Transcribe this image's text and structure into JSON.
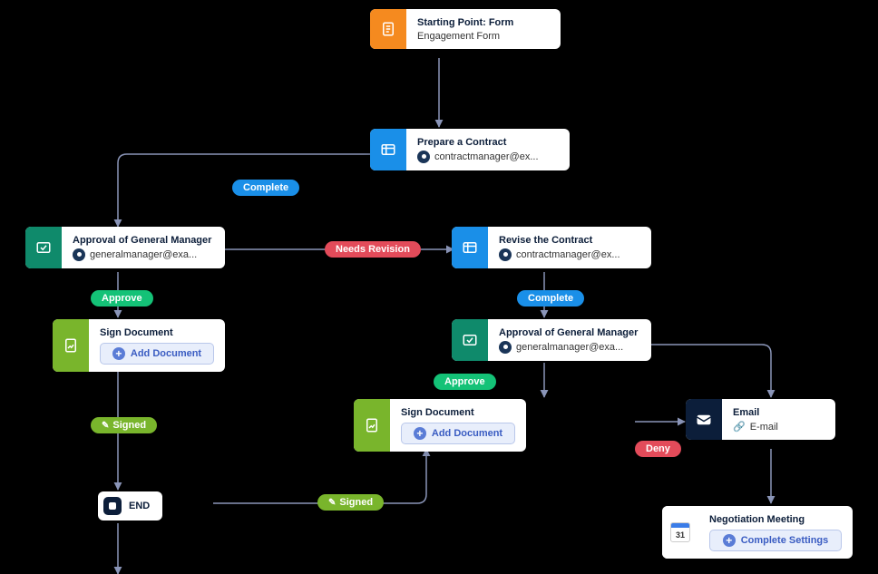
{
  "colors": {
    "orange": "#f58a1f",
    "blue": "#1a8fe8",
    "teal": "#0f8a6b",
    "lime": "#79b52c",
    "green_pill": "#14c277",
    "red_pill": "#e34b5a",
    "navy": "#0c1e3a"
  },
  "nodes": {
    "start": {
      "title": "Starting Point: Form",
      "sub": "Engagement Form"
    },
    "prepare": {
      "title": "Prepare a Contract",
      "sub": "contractmanager@ex..."
    },
    "approval1": {
      "title": "Approval of General Manager",
      "sub": "generalmanager@exa..."
    },
    "revise": {
      "title": "Revise the Contract",
      "sub": "contractmanager@ex..."
    },
    "sign1": {
      "title": "Sign Document",
      "btn": "Add Document"
    },
    "approval2": {
      "title": "Approval of General Manager",
      "sub": "generalmanager@exa..."
    },
    "sign2": {
      "title": "Sign Document",
      "btn": "Add Document"
    },
    "email": {
      "title": "Email",
      "sub": "E-mail"
    },
    "meeting": {
      "title": "Negotiation Meeting",
      "btn": "Complete Settings",
      "cal_day": "31"
    },
    "end": {
      "label": "END"
    }
  },
  "pills": {
    "complete1": "Complete",
    "approve1": "Approve",
    "needs_revision": "Needs Revision",
    "complete2": "Complete",
    "approve2": "Approve",
    "signed1": "Signed",
    "signed2": "Signed",
    "deny": "Deny"
  }
}
